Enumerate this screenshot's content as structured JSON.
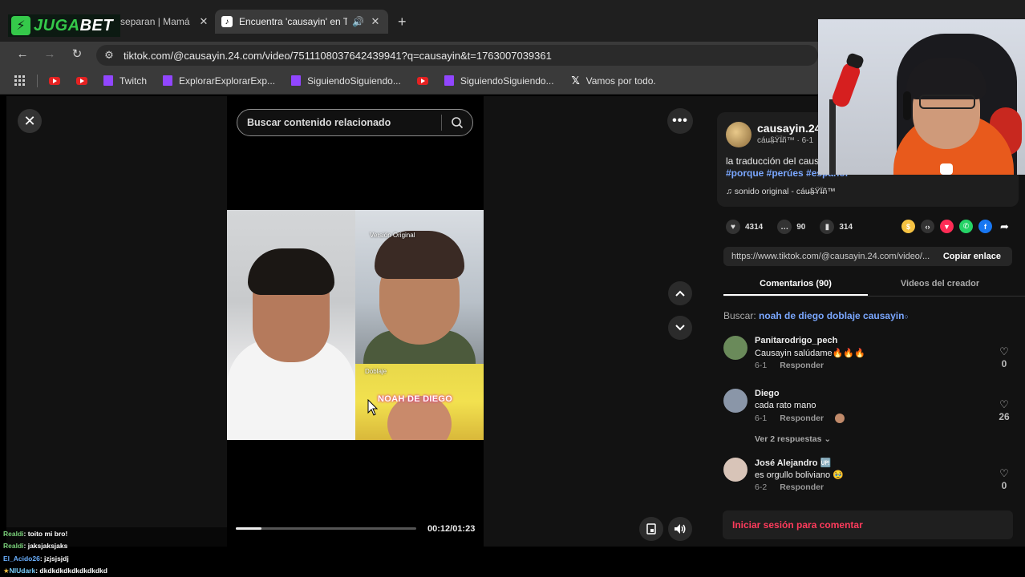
{
  "browser": {
    "logo": {
      "juga": "JUGA",
      "bet": "BET"
    },
    "tabs": [
      {
        "title": "separan | Mamá",
        "close": "✕"
      },
      {
        "title": "Encuentra 'causayin' en TikTok",
        "close": "✕"
      }
    ],
    "new_tab": "+",
    "url": "tiktok.com/@causayin.24.com/video/7511108037642439941?q=causayin&t=1763007039361",
    "bookmarks": [
      {
        "label": "",
        "type": "youtube"
      },
      {
        "label": "",
        "type": "youtube"
      },
      {
        "label": "Twitch",
        "type": "twitch"
      },
      {
        "label": "ExplorarExplorarExp...",
        "type": "twitch"
      },
      {
        "label": "SiguiendoSiguiendo...",
        "type": "twitch"
      },
      {
        "label": "",
        "type": "youtube"
      },
      {
        "label": "SiguiendoSiguiendo...",
        "type": "twitch"
      },
      {
        "label": "Vamos por todo.",
        "type": "x"
      }
    ]
  },
  "player": {
    "search_placeholder": "Buscar contenido relacionado",
    "video_label_top": "Versión Original",
    "video_label_bottom": "Doblaje",
    "caption": "NOAH DE DIEGO",
    "time": "00:12/01:23",
    "progress": 0.14
  },
  "post": {
    "username": "causayin.24",
    "subname": "cáu̶§̶ŸÏ̶ñ™ · 6-1",
    "description": "la traducción del caus",
    "tags": "#porque #perúes #español",
    "sound": "♫  sonido original - cáu̶§̶ŸÏ̶ñ™",
    "likes": "4314",
    "comments": "90",
    "saves": "314",
    "link": "https://www.tiktok.com/@causayin.24.com/video/...",
    "copy_label": "Copiar enlace"
  },
  "tabs": {
    "comments": "Comentarios (90)",
    "creator": "Videos del creador"
  },
  "search_suggestion": {
    "prefix": "Buscar:",
    "query": "noah de diego doblaje causayin"
  },
  "comments": [
    {
      "user": "Panitarodrigo_pech",
      "text": "Causayin salúdame🔥🔥🔥",
      "date": "6-1",
      "reply": "Responder",
      "likes": "0",
      "color": "#6a8a5a"
    },
    {
      "user": "Diego",
      "text": "cada rato mano",
      "date": "6-1",
      "reply": "Responder",
      "likes": "26",
      "color": "#8a96a8"
    },
    {
      "user": "José Alejandro 🆙",
      "text": "es orgullo boliviano 🥹",
      "date": "6-2",
      "reply": "Responder",
      "likes": "0",
      "color": "#d8c4b8"
    }
  ],
  "more_replies": "Ver 2 respuestas ⌄",
  "login_prompt": "Iniciar sesión para comentar",
  "chat": [
    {
      "user": "Realdi",
      "msg": ": toito mi bro!",
      "color": "#7ad17a"
    },
    {
      "user": "Realdi",
      "msg": ": jaksjaksjaks",
      "color": "#7ad17a"
    },
    {
      "user": "El_Acido26",
      "msg": ": jzjsjsjdj",
      "color": "#6ab0ff"
    },
    {
      "user": "NIUdark",
      "msg": ": dkdkdkdkdkdkdkdkd",
      "color": "#7ad1ff"
    }
  ]
}
